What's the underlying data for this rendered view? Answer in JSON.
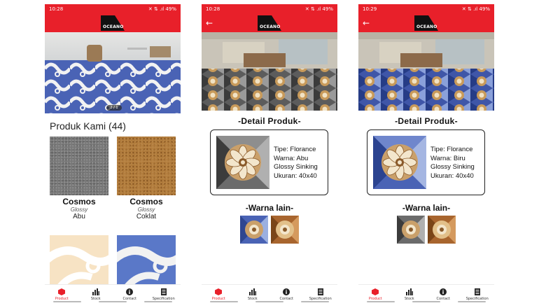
{
  "colors": {
    "brand": "#e8202a",
    "nav_active": "#e8202a"
  },
  "screens": [
    {
      "status": {
        "time": "10:28",
        "right": "✕ ⇅ .ıl 49%"
      },
      "banner_counter": "2 / 1",
      "section_title": "Produk Kami (44)",
      "products": [
        {
          "name": "Cosmos",
          "finish": "Glossy",
          "color": "Abu"
        },
        {
          "name": "Cosmos",
          "finish": "Glossy",
          "color": "Coklat"
        }
      ]
    },
    {
      "status": {
        "time": "10:28",
        "right": "✕ ⇅ .ıl 49%"
      },
      "detail_heading": "-Detail Produk-",
      "specs": [
        "Tipe: Florance",
        "Warna: Abu",
        "Glossy Sinking",
        "Ukuran: 40x40"
      ],
      "warna_heading": "-Warna lain-"
    },
    {
      "status": {
        "time": "10:29",
        "right": "✕ ⇅ .ıl 49%"
      },
      "detail_heading": "-Detail Produk-",
      "specs": [
        "Tipe: Florance",
        "Warna: Biru",
        "Glossy Sinking",
        "Ukuran: 40x40"
      ],
      "warna_heading": "-Warna lain-"
    }
  ],
  "logo_text": "OCEANO",
  "nav": [
    {
      "label": "Product",
      "icon": "box-icon"
    },
    {
      "label": "Stock",
      "icon": "bar-chart-icon"
    },
    {
      "label": "Contact",
      "icon": "info-icon"
    },
    {
      "label": "Specification",
      "icon": "document-icon"
    }
  ]
}
